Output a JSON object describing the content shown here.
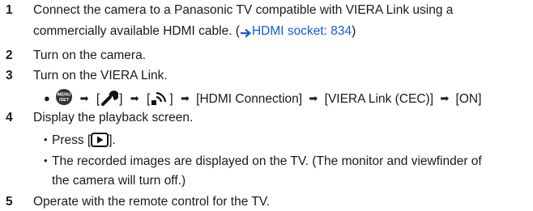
{
  "steps": [
    {
      "number": "1",
      "text_line1": "Connect the camera to a Panasonic TV compatible with VIERA Link using a",
      "text_line2_prefix": "commercially available HDMI cable. (",
      "link_text": "HDMI socket: 834",
      "text_line2_suffix": ")"
    },
    {
      "number": "2",
      "text": "Turn on the camera."
    },
    {
      "number": "3",
      "text": "Turn on the VIERA Link.",
      "menu_path": {
        "menu_button_icon": "menu-set-button-icon",
        "menu_button_label": "MENU/SET",
        "tab_icon": "wrench-setup-icon",
        "subtab_icon": "signal-output-icon",
        "item1": "[HDMI Connection]",
        "item2": "[VIERA Link (CEC)]",
        "item3": "[ON]"
      }
    },
    {
      "number": "4",
      "text": "Display the playback screen.",
      "bullets": {
        "press_prefix": "Press [",
        "press_suffix": "].",
        "playback_icon": "playback-button-icon",
        "note_line1": "The recorded images are displayed on the TV. (The monitor and viewfinder of",
        "note_line2": "the camera will turn off.)"
      }
    },
    {
      "number": "5",
      "text": "Operate with the remote control for the TV."
    }
  ],
  "colors": {
    "text": "#1a1a1a",
    "link": "#1a57d6"
  }
}
